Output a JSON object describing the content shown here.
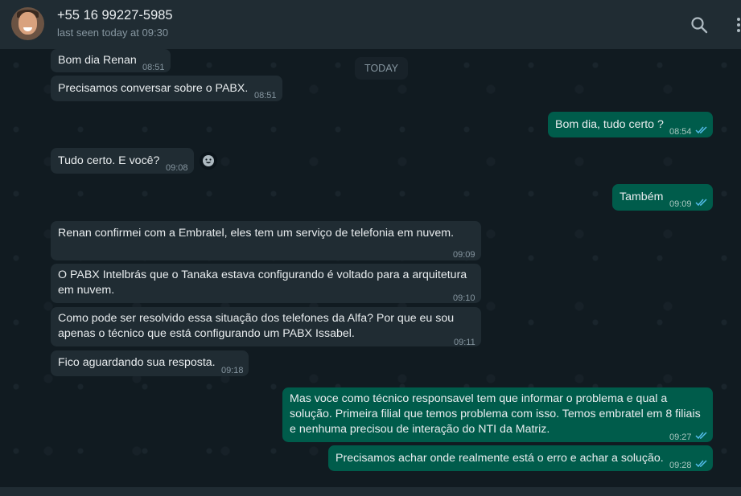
{
  "header": {
    "contact_name": "+55 16 99227-5985",
    "status": "last seen today at 09:30",
    "icons": [
      "search-icon",
      "menu-icon"
    ]
  },
  "date_divider": "TODAY",
  "colors": {
    "incoming_bubble": "#202c33",
    "outgoing_bubble": "#005c4b",
    "read_ticks": "#53bdeb",
    "header_bg": "#202c33",
    "chat_bg": "#111b21"
  },
  "messages": [
    {
      "direction": "in",
      "text": "Bom dia Renan",
      "time": "08:51"
    },
    {
      "direction": "in",
      "text": "Precisamos conversar sobre o PABX.",
      "time": "08:51"
    },
    {
      "direction": "out",
      "text": "Bom dia, tudo certo ?",
      "time": "08:54",
      "status": "read"
    },
    {
      "direction": "in",
      "text": "Tudo certo. E você?",
      "time": "09:08"
    },
    {
      "direction": "out",
      "text": "Também",
      "time": "09:09",
      "status": "read"
    },
    {
      "direction": "in",
      "text": "Renan confirmei com a Embratel, eles tem um serviço de telefonia em nuvem.",
      "time": "09:09"
    },
    {
      "direction": "in",
      "text": "O PABX Intelbrás que o Tanaka estava configurando é voltado para a arquitetura em nuvem.",
      "time": "09:10"
    },
    {
      "direction": "in",
      "text": "Como pode ser resolvido essa situação dos telefones da Alfa? Por que eu sou apenas o técnico que está configurando um PABX Issabel.",
      "time": "09:11"
    },
    {
      "direction": "in",
      "text": "Fico aguardando sua resposta.",
      "time": "09:18"
    },
    {
      "direction": "out",
      "text": "Mas voce como técnico responsavel tem que informar o problema e qual a solução. Primeira filial que temos problema com isso. Temos embratel em 8 filiais e nenhuma precisou de interação do NTI da Matriz.",
      "time": "09:27",
      "status": "read"
    },
    {
      "direction": "out",
      "text": "Precisamos achar onde realmente está o erro e achar a solução.",
      "time": "09:28",
      "status": "read"
    }
  ]
}
